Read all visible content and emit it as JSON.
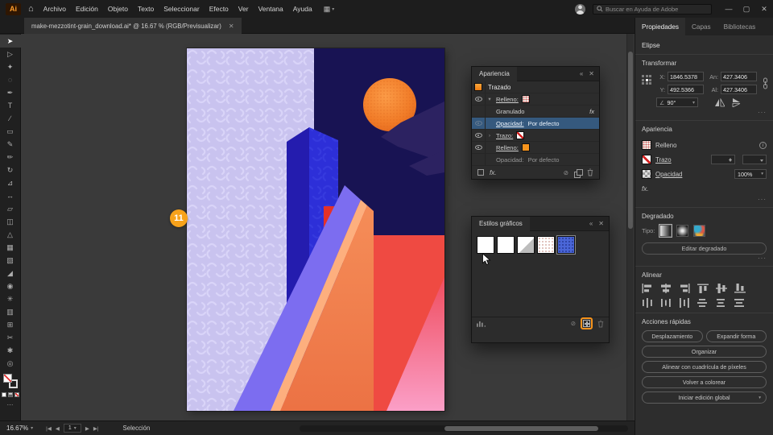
{
  "app": {
    "logo_text": "Ai",
    "menus": [
      "Archivo",
      "Edición",
      "Objeto",
      "Texto",
      "Seleccionar",
      "Efecto",
      "Ver",
      "Ventana",
      "Ayuda"
    ],
    "search_placeholder": "Buscar en Ayuda de Adobe",
    "icons": {
      "home": "⌂",
      "workspace": "▦",
      "caret": "▾",
      "minimize": "—",
      "maximize": "▢",
      "close": "✕"
    }
  },
  "document_tab": {
    "title": "make-mezzotint-grain_download.ai* @ 16.67 % (RGB/Previsualizar)",
    "close_icon": "✕"
  },
  "tools": [
    {
      "name": "selection-tool",
      "glyph": "➤"
    },
    {
      "name": "direct-selection-tool",
      "glyph": "▷"
    },
    {
      "name": "magic-wand-tool",
      "glyph": "✦"
    },
    {
      "name": "lasso-tool",
      "glyph": "◌"
    },
    {
      "name": "pen-tool",
      "glyph": "✒"
    },
    {
      "name": "type-tool",
      "glyph": "T"
    },
    {
      "name": "line-segment-tool",
      "glyph": "∕"
    },
    {
      "name": "rectangle-tool",
      "glyph": "▭"
    },
    {
      "name": "paintbrush-tool",
      "glyph": "✎"
    },
    {
      "name": "pencil-tool",
      "glyph": "✏"
    },
    {
      "name": "rotate-tool",
      "glyph": "↻"
    },
    {
      "name": "scale-tool",
      "glyph": "⊿"
    },
    {
      "name": "width-tool",
      "glyph": "↔"
    },
    {
      "name": "free-transform-tool",
      "glyph": "▱"
    },
    {
      "name": "shape-builder-tool",
      "glyph": "◫"
    },
    {
      "name": "perspective-grid-tool",
      "glyph": "△"
    },
    {
      "name": "mesh-tool",
      "glyph": "▦"
    },
    {
      "name": "gradient-tool",
      "glyph": "▧"
    },
    {
      "name": "eyedropper-tool",
      "glyph": "◢"
    },
    {
      "name": "blend-tool",
      "glyph": "◉"
    },
    {
      "name": "symbol-sprayer-tool",
      "glyph": "✳"
    },
    {
      "name": "column-graph-tool",
      "glyph": "▥"
    },
    {
      "name": "artboard-tool",
      "glyph": "⊞"
    },
    {
      "name": "slice-tool",
      "glyph": "✂"
    },
    {
      "name": "hand-tool",
      "glyph": "✱"
    },
    {
      "name": "zoom-tool",
      "glyph": "◎"
    }
  ],
  "toolbar_footer": {
    "more": "⋯"
  },
  "annotation": {
    "number": "11"
  },
  "panels": {
    "appearance": {
      "title": "Apariencia",
      "collapse_icon": "«",
      "close_icon": "✕",
      "item_label": "Trazado",
      "expanded_icon": "▾",
      "collapsed_icon": "›",
      "rows": [
        {
          "label": "Relleno:"
        },
        {
          "label": "Granulado",
          "fx": "fx"
        },
        {
          "label": "Opacidad:",
          "value": "Por defecto"
        },
        {
          "label": "Trazo:"
        },
        {
          "label": "Relleno:"
        },
        {
          "label": "Opacidad:",
          "value": "Por defecto"
        }
      ],
      "footer": {
        "fx": "fx.",
        "clear": "⊘"
      }
    },
    "graphic_styles": {
      "title": "Estilos gráficos",
      "collapse_icon": "«",
      "close_icon": "✕",
      "footer": {
        "clear": "⊘"
      }
    }
  },
  "properties": {
    "tabs": [
      "Propiedades",
      "Capas",
      "Bibliotecas"
    ],
    "selection_type": "Elipse",
    "transform": {
      "title": "Transformar",
      "x_label": "X:",
      "x_value": "1846.5378",
      "y_label": "Y:",
      "y_value": "492.5366",
      "w_label": "An:",
      "w_value": "427.3406",
      "h_label": "Al:",
      "h_value": "427.3406",
      "angle_icon": "∠",
      "angle_value": "90°",
      "angle_caret": "▾"
    },
    "appearance": {
      "title": "Apariencia",
      "fill_label": "Relleno",
      "info_icon": "i",
      "stroke_label": "Trazo",
      "opacity_label": "Opacidad",
      "opacity_value": "100%",
      "opacity_caret": "▾",
      "fx_label": "fx."
    },
    "gradient": {
      "title": "Degradado",
      "type_label": "Tipo:",
      "edit_button": "Editar degradado"
    },
    "align": {
      "title": "Alinear"
    },
    "quick_actions": {
      "title": "Acciones rápidas",
      "buttons": [
        "Desplazamiento",
        "Expandir forma",
        "Organizar",
        "Alinear con cuadrícula de píxeles",
        "Volver a colorear",
        "Iniciar edición global"
      ],
      "caret": "▾"
    },
    "more_icon": "···"
  },
  "statusbar": {
    "zoom": "16.67%",
    "caret": "▾",
    "first": "|◀",
    "prev": "◀",
    "page": "1",
    "next": "▶",
    "last": "▶|",
    "status": "Selección"
  },
  "colors": {
    "accent_orange": "#F7941D",
    "selection_blue": "#35597E",
    "artwork": {
      "lavender": "#C9C3EF",
      "navy": "#181353",
      "blue": "#2D2FD8",
      "violet": "#7C6DF0",
      "orange": "#EF7C4C",
      "red": "#E63128",
      "coral": "#EF4A42",
      "pink": "#FB9FC7",
      "sun": "#F28433"
    }
  }
}
